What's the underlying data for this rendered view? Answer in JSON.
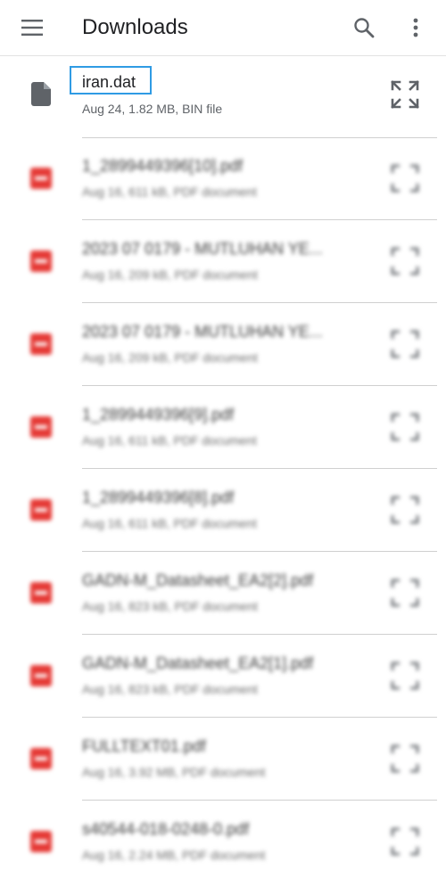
{
  "appbar": {
    "title": "Downloads",
    "menu_icon": "menu-icon",
    "search_icon": "search-icon",
    "overflow_icon": "more-vert-icon"
  },
  "files": [
    {
      "name": "iran.dat",
      "meta": "Aug 24, 1.82 MB, BIN file",
      "icon": "file-icon",
      "selected": true
    },
    {
      "name": "1_2899449396[10].pdf",
      "meta": "Aug 16, 611 kB, PDF document",
      "icon": "pdf-icon"
    },
    {
      "name": "2023 07 0179 - MUTLUHAN YE...",
      "meta": "Aug 16, 209 kB, PDF document",
      "icon": "pdf-icon"
    },
    {
      "name": "2023 07 0179 - MUTLUHAN YE...",
      "meta": "Aug 16, 209 kB, PDF document",
      "icon": "pdf-icon"
    },
    {
      "name": "1_2899449396[9].pdf",
      "meta": "Aug 16, 611 kB, PDF document",
      "icon": "pdf-icon"
    },
    {
      "name": "1_2899449396[8].pdf",
      "meta": "Aug 16, 611 kB, PDF document",
      "icon": "pdf-icon"
    },
    {
      "name": "GADN-M_Datasheet_EA2[2].pdf",
      "meta": "Aug 16, 823 kB, PDF document",
      "icon": "pdf-icon"
    },
    {
      "name": "GADN-M_Datasheet_EA2[1].pdf",
      "meta": "Aug 16, 823 kB, PDF document",
      "icon": "pdf-icon"
    },
    {
      "name": "FULLTEXT01.pdf",
      "meta": "Aug 16, 3.92 MB, PDF document",
      "icon": "pdf-icon"
    },
    {
      "name": "s40544-018-0248-0.pdf",
      "meta": "Aug 16, 2.24 MB, PDF document",
      "icon": "pdf-icon"
    }
  ],
  "colors": {
    "pdf_red": "#e53935",
    "selection_border": "#2f9be4",
    "icon_gray": "#5f6368"
  }
}
